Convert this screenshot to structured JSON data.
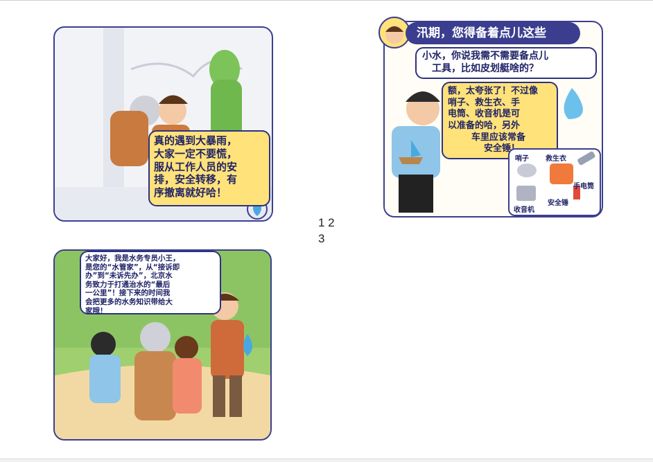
{
  "page_numbers": {
    "line1": "1 2",
    "line2": "3"
  },
  "panel1": {
    "bubble": [
      "真的遇到大暴雨，",
      "大家一定不要慌，",
      "服从工作人员的安",
      "排，安全转移，有",
      "序撤离就好哈！"
    ]
  },
  "panel2": {
    "title": "汛期，您得备着点儿这些",
    "question": [
      "小水，你说我需不需要备点儿",
      "工具，比如皮划艇啥的？"
    ],
    "answer": [
      "额，太夸张了！不过像",
      "哨子、救生衣、手",
      "电筒、收音机是可",
      "以准备的哈，另外",
      "车里应该常备",
      "安全锤！"
    ],
    "items": {
      "whistle": "哨子",
      "vest": "救生衣",
      "flashlight": "手电筒",
      "hammer": "安全锤",
      "radio": "收音机"
    }
  },
  "panel3": {
    "bubble": [
      "大家好，我是水务专员小王，",
      "是您的“水管家”，从“接诉即",
      "办”到“未诉先办”，北京水",
      "务致力于打通治水的“最后",
      "一公里”！接下来的时间我",
      "会把更多的水务知识带给大",
      "家哦！"
    ]
  },
  "colors": {
    "outline": "#3b3e8f",
    "bubble_yellow": "#ffe27a",
    "text_navy": "#1f2366"
  }
}
